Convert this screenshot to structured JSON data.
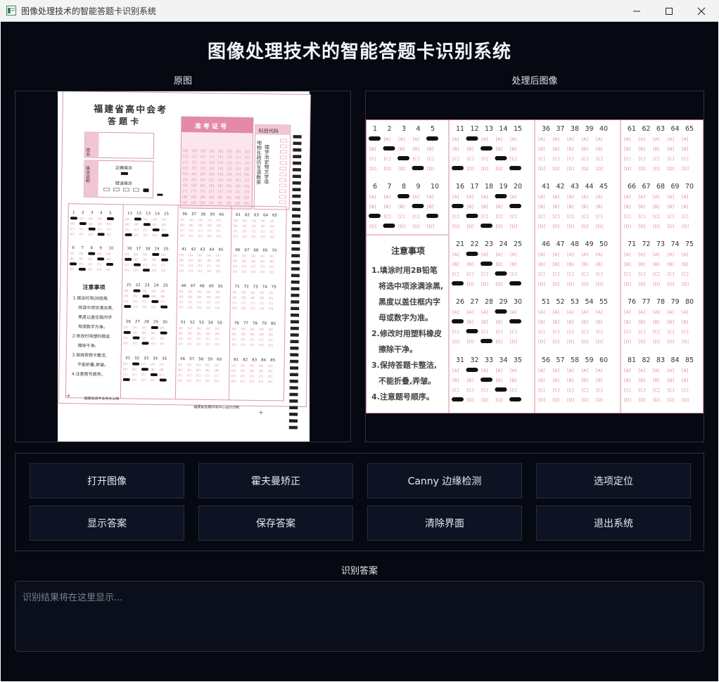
{
  "window": {
    "title": "图像处理技术的智能答题卡识别系统",
    "controls": {
      "minimize": "—",
      "maximize": "☐",
      "close": "✕"
    }
  },
  "app": {
    "heading": "图像处理技术的智能答题卡识别系统"
  },
  "panels": {
    "original": {
      "label": "原图"
    },
    "processed": {
      "label": "处理后图像"
    }
  },
  "original_card": {
    "province_title": "福建省高中会考",
    "card_title": "答 题 卡",
    "name_label": "姓名",
    "fill_note_label": "填涂说明",
    "correct_fill": "正确填涂",
    "wrong_fill": "错误填涂",
    "exam_id_label": "准 考 证 号",
    "subject_code_label": "科目代码",
    "subjects_line1": "地物化政历生语数英",
    "subjects_line2": "理学治史物文学语",
    "notice_title": "注意事项",
    "notice_items": [
      "1.填涂时用2B铅笔",
      "将选中项涂满涂黑,",
      "黑度以盖住框内字",
      "母或数字为准。",
      "2.修改时用塑料橡皮",
      "擦除干净。",
      "3.保持答题卡整洁,",
      "不能折叠,弄皱。",
      "4.注意题号顺序。"
    ],
    "footer_left": "福建省高中会考办公制",
    "footer_right": "福建省金穗印务中心设计印制"
  },
  "processed_card": {
    "notice_title": "注意事项",
    "notice_lines": [
      "1.填涂时用2B铅笔",
      "将选中项涂满涂黑,",
      "黑度以盖住框内字",
      "母或数字为准。",
      "2.修改时用塑料橡皮",
      "擦除干净。",
      "3.保持答题卡整洁,",
      "不能折叠,弄皱。",
      "4.注意题号顺序。"
    ]
  },
  "buttons": {
    "open_image": "打开图像",
    "hough_correct": "霍夫曼矫正",
    "canny_detect": "Canny 边缘检测",
    "option_locate": "选项定位",
    "show_answer": "显示答案",
    "save_answer": "保存答案",
    "clear_ui": "清除界面",
    "exit_system": "退出系统"
  },
  "result": {
    "label": "识别答案",
    "placeholder": "识别结果将在这里显示..."
  },
  "colors": {
    "background": "#060912",
    "button_bg": "#0d1322",
    "border": "#2a3142",
    "card_pink": "#e48aa8",
    "card_mark": "#111111"
  }
}
